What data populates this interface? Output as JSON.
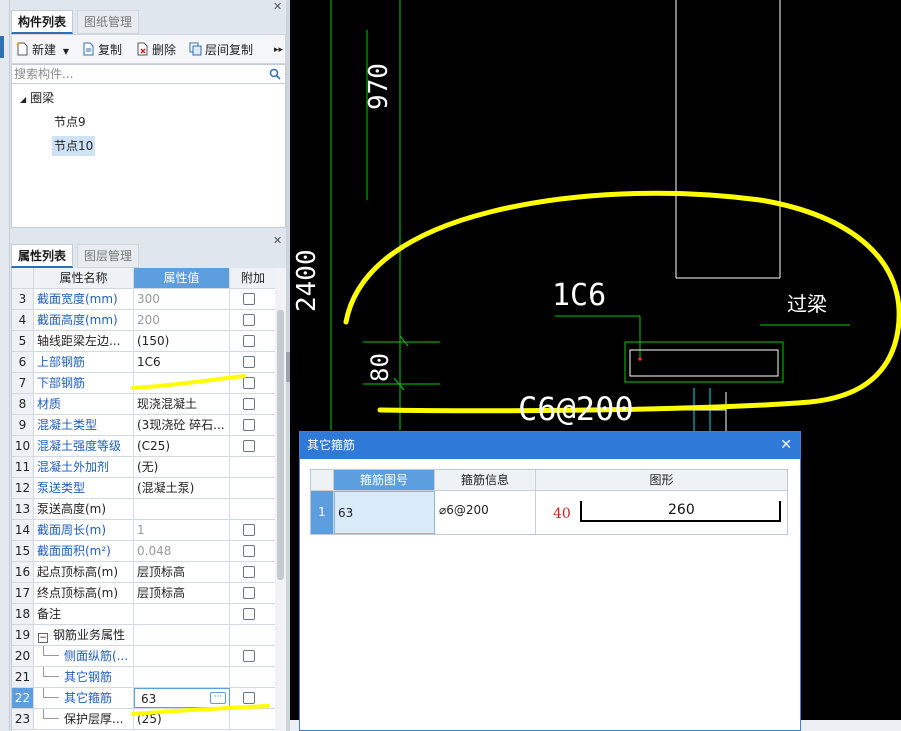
{
  "component_panel": {
    "tabs": [
      "构件列表",
      "图纸管理"
    ],
    "toolbar": {
      "new": "新建",
      "copy": "复制",
      "delete": "删除",
      "floor_copy": "层间复制"
    },
    "search_placeholder": "搜索构件...",
    "tree": {
      "root": "圈梁",
      "children": [
        "节点9",
        "节点10"
      ],
      "selected": "节点10"
    }
  },
  "property_panel": {
    "tabs": [
      "属性列表",
      "图层管理"
    ],
    "columns": [
      "属性名称",
      "属性值",
      "附加"
    ],
    "rows": [
      {
        "n": "3",
        "name": "截面宽度(mm)",
        "value": "300",
        "blue": true,
        "gray": true,
        "check": true
      },
      {
        "n": "4",
        "name": "截面高度(mm)",
        "value": "200",
        "blue": true,
        "gray": true,
        "check": true
      },
      {
        "n": "5",
        "name": "轴线距梁左边...",
        "value": "(150)",
        "blue": false,
        "gray": false,
        "check": true
      },
      {
        "n": "6",
        "name": "上部钢筋",
        "value": "1C6",
        "blue": true,
        "gray": false,
        "check": true
      },
      {
        "n": "7",
        "name": "下部钢筋",
        "value": "",
        "blue": true,
        "gray": false,
        "check": true
      },
      {
        "n": "8",
        "name": "材质",
        "value": "现浇混凝土",
        "blue": true,
        "gray": false,
        "check": true
      },
      {
        "n": "9",
        "name": "混凝土类型",
        "value": "(3现浇砼 碎石...",
        "blue": true,
        "gray": false,
        "check": true
      },
      {
        "n": "10",
        "name": "混凝土强度等级",
        "value": "(C25)",
        "blue": true,
        "gray": false,
        "check": true
      },
      {
        "n": "11",
        "name": "混凝土外加剂",
        "value": "(无)",
        "blue": true,
        "gray": false,
        "check": false
      },
      {
        "n": "12",
        "name": "泵送类型",
        "value": "(混凝土泵)",
        "blue": true,
        "gray": false,
        "check": false
      },
      {
        "n": "13",
        "name": "泵送高度(m)",
        "value": "",
        "blue": false,
        "gray": false,
        "check": false
      },
      {
        "n": "14",
        "name": "截面周长(m)",
        "value": "1",
        "blue": true,
        "gray": true,
        "check": true
      },
      {
        "n": "15",
        "name": "截面面积(m²)",
        "value": "0.048",
        "blue": true,
        "gray": true,
        "check": true
      },
      {
        "n": "16",
        "name": "起点顶标高(m)",
        "value": "层顶标高",
        "blue": false,
        "gray": false,
        "check": true
      },
      {
        "n": "17",
        "name": "终点顶标高(m)",
        "value": "层顶标高",
        "blue": false,
        "gray": false,
        "check": true
      },
      {
        "n": "18",
        "name": "备注",
        "value": "",
        "blue": false,
        "gray": false,
        "check": true
      },
      {
        "n": "19",
        "name": "钢筋业务属性",
        "value": "",
        "blue": false,
        "gray": false,
        "check": false,
        "group": true
      },
      {
        "n": "20",
        "name": "侧面纵筋(...",
        "value": "",
        "blue": true,
        "gray": false,
        "check": true,
        "indent": true
      },
      {
        "n": "21",
        "name": "其它钢筋",
        "value": "",
        "blue": true,
        "gray": false,
        "check": false,
        "indent": true
      },
      {
        "n": "22",
        "name": "其它箍筋",
        "value": "63",
        "blue": true,
        "gray": false,
        "check": true,
        "indent": true,
        "editing": true
      },
      {
        "n": "23",
        "name": "保护层厚...",
        "value": "(25)",
        "blue": false,
        "gray": false,
        "check": false,
        "indent": true
      }
    ]
  },
  "cad": {
    "dims": {
      "d970": "970",
      "d2400": "2400",
      "d80": "80"
    },
    "labels": {
      "rebar": "1C6",
      "stirrup": "C6@200",
      "lintel": "过梁"
    },
    "colors": {
      "annotation": "#ffff00",
      "line_green": "#00cc00",
      "line_white": "#ffffff",
      "line_cyan": "#00e0e0",
      "point_red": "#ff2020"
    }
  },
  "dialog": {
    "title": "其它箍筋",
    "columns": [
      "箍筋图号",
      "箍筋信息",
      "图形"
    ],
    "row": {
      "index": "1",
      "shape_no": "63",
      "info": "⌀6@200",
      "dim_left": "40",
      "dim_main": "260"
    }
  }
}
